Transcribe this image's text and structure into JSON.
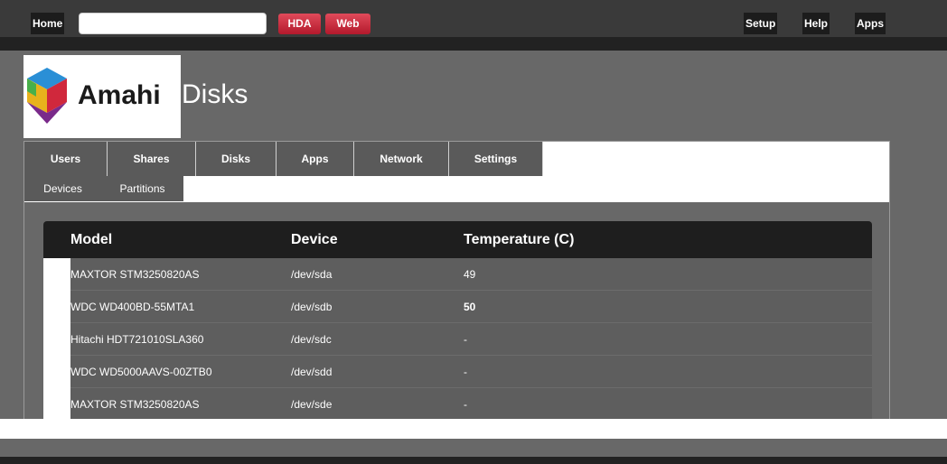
{
  "topnav": {
    "home": "Home",
    "search_value": "",
    "hda_button": "HDA",
    "web_button": "Web",
    "setup": "Setup",
    "help": "Help",
    "apps": "Apps"
  },
  "logo_text": "Amahi",
  "page_title": "Disks",
  "tabs": [
    "Users",
    "Shares",
    "Disks",
    "Apps",
    "Network",
    "Settings"
  ],
  "subtabs": [
    "Devices",
    "Partitions"
  ],
  "table": {
    "headers": [
      "Model",
      "Device",
      "Temperature (C)"
    ],
    "rows": [
      {
        "model": "MAXTOR STM3250820AS",
        "device": "/dev/sda",
        "temp": "49"
      },
      {
        "model": "WDC WD400BD-55MTA1",
        "device": "/dev/sdb",
        "temp": "50"
      },
      {
        "model": "Hitachi HDT721010SLA360",
        "device": "/dev/sdc",
        "temp": "-"
      },
      {
        "model": "WDC WD5000AAVS-00ZTB0",
        "device": "/dev/sdd",
        "temp": "-"
      },
      {
        "model": "MAXTOR STM3250820AS",
        "device": "/dev/sde",
        "temp": "-"
      }
    ]
  },
  "colors": {
    "accent_red": "#c8283a",
    "header_dark": "#1e1e1e",
    "background": "#686868"
  }
}
